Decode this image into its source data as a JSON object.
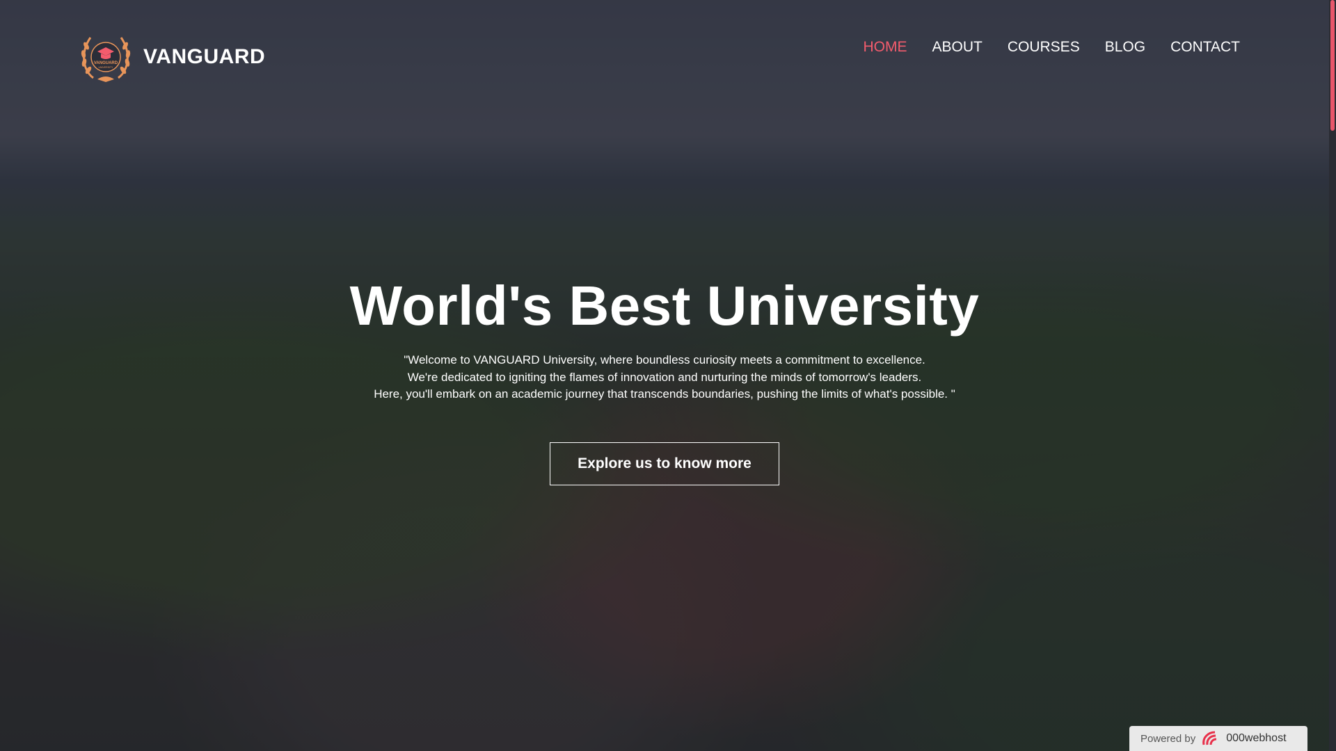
{
  "brand": {
    "name": "VANGUARD",
    "logo_icon": "laurel-graduation-cap-icon",
    "logo_text": "VANGUARD",
    "logo_subtext": "UNIVERSITY",
    "accent_color": "#f45c6d",
    "logo_color": "#e8955a"
  },
  "nav": {
    "items": [
      {
        "label": "HOME",
        "active": true
      },
      {
        "label": "ABOUT",
        "active": false
      },
      {
        "label": "COURSES",
        "active": false
      },
      {
        "label": "BLOG",
        "active": false
      },
      {
        "label": "CONTACT",
        "active": false
      }
    ]
  },
  "hero": {
    "title": "World's Best University",
    "description_lines": [
      "\"Welcome to VANGUARD University, where boundless curiosity meets a commitment to excellence.",
      "We're dedicated to igniting the flames of innovation and nurturing the minds of tomorrow's leaders.",
      "Here, you'll embark on an academic journey that transcends boundaries, pushing the limits of what's possible. \""
    ],
    "cta_label": "Explore us to know more"
  },
  "footer_badge": {
    "prefix": "Powered by",
    "host": "000webhost",
    "icon": "000webhost-logo-icon"
  }
}
